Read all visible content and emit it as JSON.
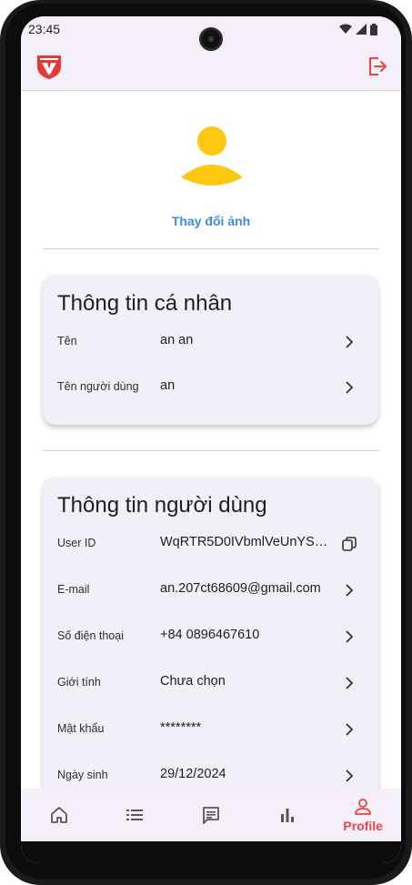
{
  "status_bar": {
    "time": "23:45"
  },
  "app_bar": {
    "logo": "shield-logo",
    "logout_icon": "logout-icon"
  },
  "profile": {
    "change_photo_label": "Thay đổi ảnh"
  },
  "personal_info": {
    "title": "Thông tin cá nhân",
    "rows": [
      {
        "label": "Tên",
        "value": "an an",
        "action_icon": "chevron-right-icon"
      },
      {
        "label": "Tên người dùng",
        "value": "an",
        "action_icon": "chevron-right-icon"
      }
    ]
  },
  "user_info": {
    "title": "Thông tin người dùng",
    "rows": [
      {
        "label": "User ID",
        "value": "WqRTR5D0IVbmlVeUnYSO…",
        "action_icon": "copy-icon"
      },
      {
        "label": "E-mail",
        "value": "an.207ct68609@gmail.com",
        "action_icon": "chevron-right-icon"
      },
      {
        "label": "Số điện thoại",
        "value": "+84 0896467610",
        "action_icon": "chevron-right-icon"
      },
      {
        "label": "Giới tính",
        "value": "Chưa chọn",
        "action_icon": "chevron-right-icon"
      },
      {
        "label": "Mật khẩu",
        "value": "********",
        "action_icon": "chevron-right-icon"
      },
      {
        "label": "Ngày sinh",
        "value": "29/12/2024",
        "action_icon": "chevron-right-icon"
      }
    ]
  },
  "bottom_nav": {
    "items": [
      {
        "icon": "home-icon",
        "label": ""
      },
      {
        "icon": "list-icon",
        "label": ""
      },
      {
        "icon": "message-icon",
        "label": ""
      },
      {
        "icon": "bar-chart-icon",
        "label": ""
      },
      {
        "icon": "profile-icon",
        "label": "Profile",
        "active": true
      }
    ]
  },
  "colors": {
    "accent": "#ee4343",
    "link": "#3d8be6",
    "avatar": "#fdc80f",
    "surface": "#f4eff8"
  }
}
